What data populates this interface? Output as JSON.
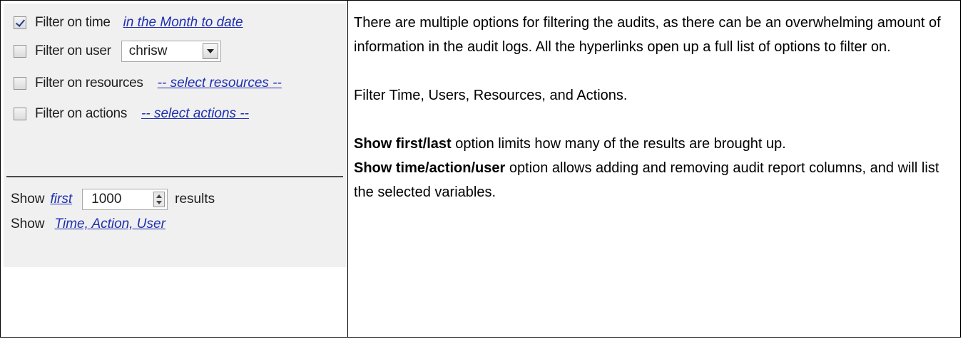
{
  "panel": {
    "filters": [
      {
        "checked": true,
        "label": "Filter on time",
        "link": "in the Month to date"
      },
      {
        "checked": false,
        "label": "Filter on user",
        "combo_value": "chrisw"
      },
      {
        "checked": false,
        "label": "Filter on resources",
        "link": "-- select resources --"
      },
      {
        "checked": false,
        "label": "Filter on actions",
        "link": "-- select actions --"
      }
    ],
    "show_first": {
      "prefix": "Show",
      "link": "first",
      "value": "1000",
      "suffix": "results"
    },
    "show_columns": {
      "prefix": "Show",
      "link": "Time, Action, User"
    }
  },
  "text": {
    "p1": "There are multiple options for filtering the audits, as there can be an overwhelming amount of information in the audit logs. All the hyperlinks open up a full list of options to filter on.",
    "p2": "Filter Time, Users, Resources, and Actions.",
    "p3_bold": "Show first/last",
    "p3_rest": " option limits how many of the results are brought up.",
    "p4_bold": "Show time/action/user",
    "p4_rest": " option allows adding and removing audit report columns, and will list the selected variables."
  }
}
